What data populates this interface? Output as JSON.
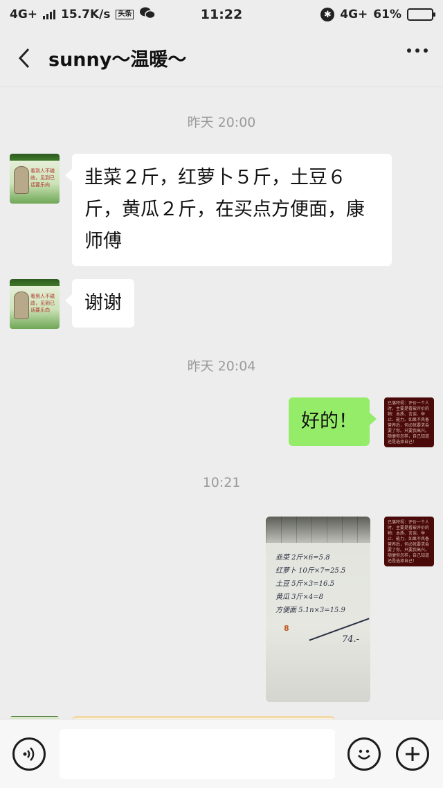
{
  "status_bar": {
    "network": "4G+",
    "speed": "15.7K/s",
    "badge": "头条",
    "time": "11:22",
    "network_right": "4G+",
    "battery_percent": "61%",
    "battery_level": 0.61,
    "icons": [
      "signal-icon",
      "toutiao-badge-icon",
      "wechat-icon",
      "bluetooth-icon",
      "battery-icon"
    ]
  },
  "header": {
    "title": "sunny～温暖～",
    "back_icon": "chevron-left-icon",
    "more_icon": "more-dots-icon"
  },
  "chat": {
    "time_labels": [
      "昨天 20:00",
      "昨天 20:04",
      "10:21"
    ],
    "messages": [
      {
        "side": "left",
        "text": "韭菜２斤，红萝卜５斤，土豆６斤，黄瓜２斤，在买点方便面，康师傅"
      },
      {
        "side": "left",
        "text": "谢谢"
      },
      {
        "side": "right",
        "text": "好的！"
      },
      {
        "side": "right",
        "type": "image"
      }
    ],
    "avatar_left_text": "看到人不磁歧，见到已话要乐向",
    "avatar_right_text": "已落特视：评价一个人时，主要是看被评价的物：本质、言谈、举止、能力、如果不具备营养后，何必就要求会要了你。只要我高兴。随便你怎样，自己知道还是选择自己！",
    "photo_handwriting": [
      "韭菜 2斤×6=5.8",
      "红萝卜 10斤×7=25.5",
      "土豆 5斤×3=16.5",
      "黄瓜 3斤×4=8",
      "方便面 5.1n×3=15.9"
    ],
    "photo_mark": "8",
    "photo_total": "74.-"
  },
  "input_bar": {
    "voice_icon": "voice-icon",
    "emoji_icon": "emoji-icon",
    "plus_icon": "plus-icon",
    "input_value": ""
  }
}
